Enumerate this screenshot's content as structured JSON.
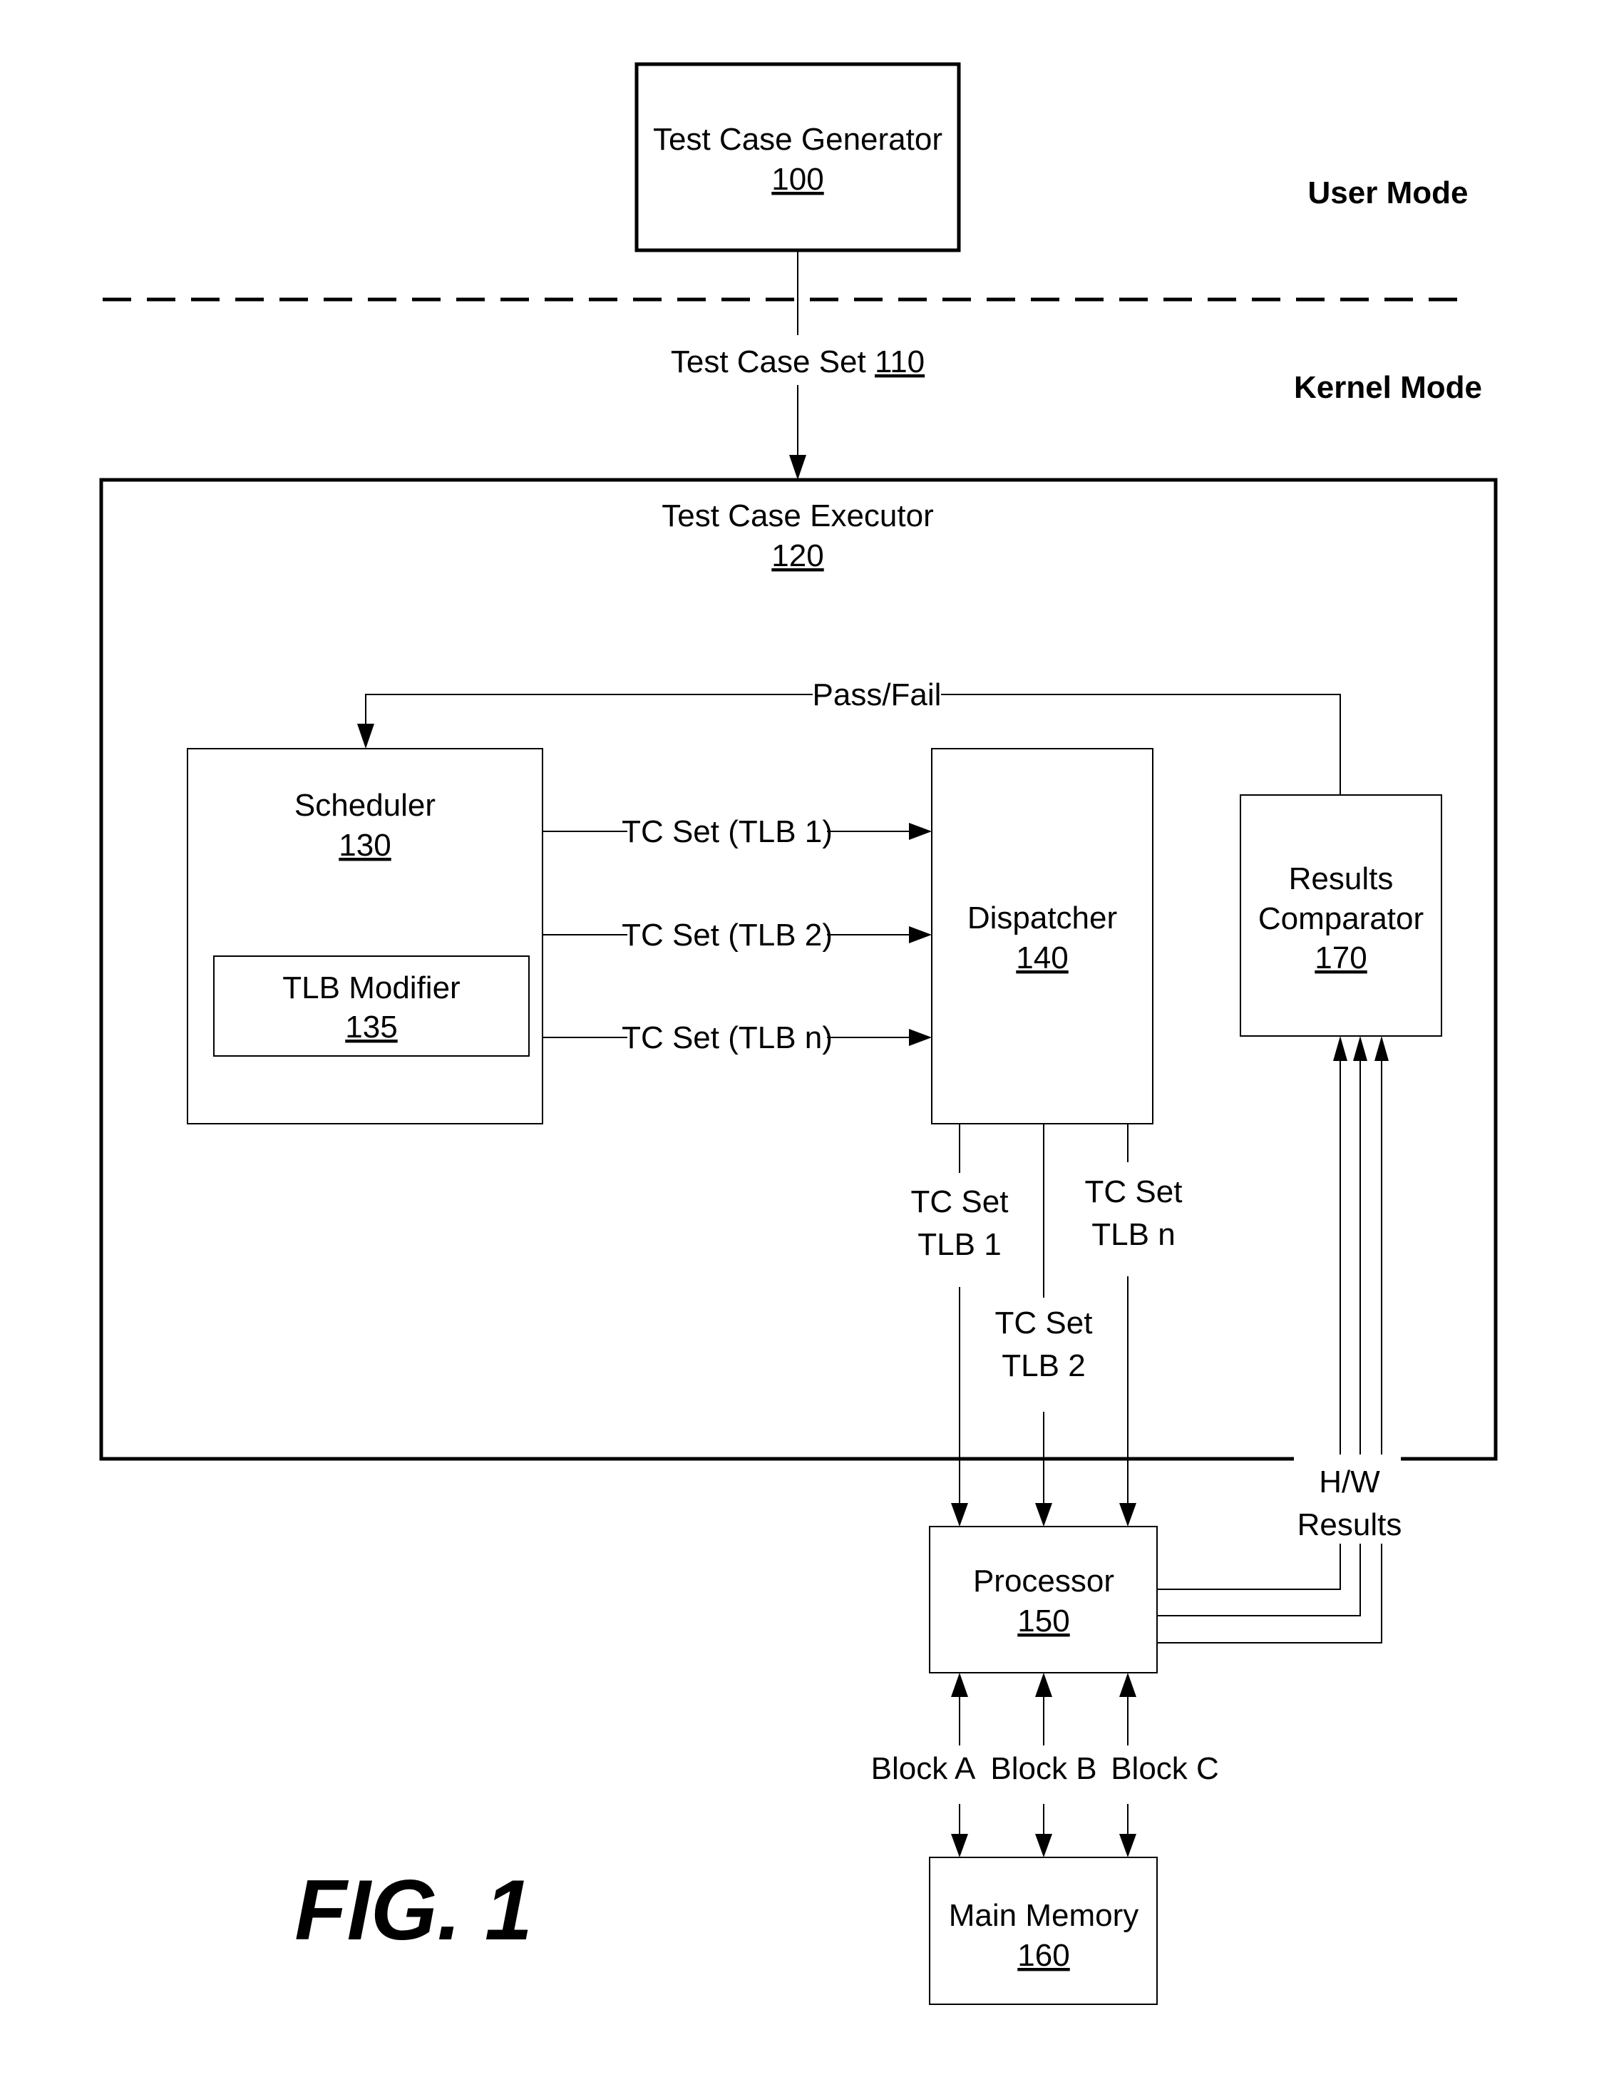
{
  "figure_label": "FIG. 1",
  "zones": {
    "user_mode": "User Mode",
    "kernel_mode": "Kernel Mode"
  },
  "nodes": {
    "test_case_generator": {
      "label": "Test Case Generator",
      "ref": "100"
    },
    "test_case_executor": {
      "label": "Test Case Executor",
      "ref": "120"
    },
    "scheduler": {
      "label": "Scheduler",
      "ref": "130"
    },
    "tlb_modifier": {
      "label": "TLB Modifier",
      "ref": "135"
    },
    "dispatcher": {
      "label": "Dispatcher",
      "ref": "140"
    },
    "results_comparator": {
      "label_line1": "Results",
      "label_line2": "Comparator",
      "ref": "170"
    },
    "processor": {
      "label": "Processor",
      "ref": "150"
    },
    "main_memory": {
      "label": "Main Memory",
      "ref": "160"
    }
  },
  "edges": {
    "test_case_set": {
      "label": "Test Case Set ",
      "ref": "110"
    },
    "pass_fail": "Pass/Fail",
    "tc_set_tlb": [
      "TC Set (TLB 1)",
      "TC Set (TLB 2)",
      "TC Set (TLB n)"
    ],
    "dispatch": [
      {
        "line1": "TC Set",
        "line2": "TLB 1"
      },
      {
        "line1": "TC Set",
        "line2": "TLB 2"
      },
      {
        "line1": "TC Set",
        "line2": "TLB n"
      }
    ],
    "hw_results": {
      "line1": "H/W",
      "line2": "Results"
    },
    "blocks": [
      "Block A",
      "Block B",
      "Block C"
    ]
  }
}
